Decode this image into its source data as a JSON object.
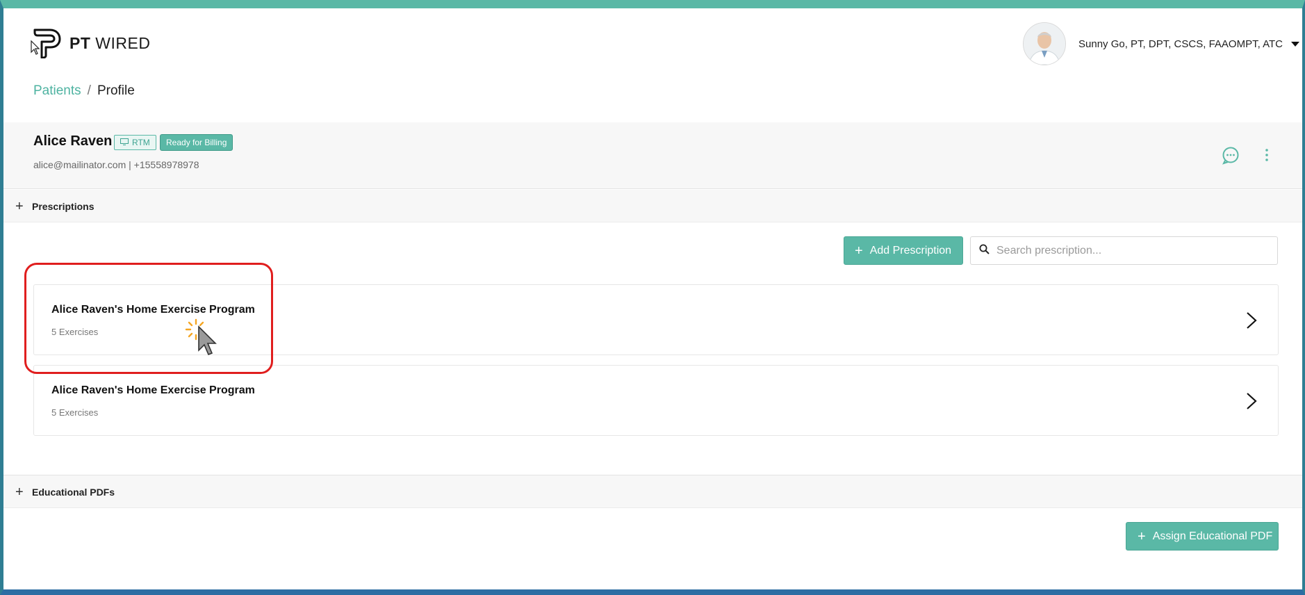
{
  "brand": {
    "name_bold": "PT",
    "name_rest": "WIRED"
  },
  "user": {
    "name": "Sunny Go, PT, DPT, CSCS, FAAOMPT, ATC"
  },
  "breadcrumb": {
    "parent": "Patients",
    "separator": "/",
    "current": "Profile"
  },
  "patient": {
    "name": "Alice Raven",
    "tags": {
      "rtm": "RTM",
      "billing": "Ready for Billing"
    },
    "contact": "alice@mailinator.com | +15558978978"
  },
  "prescriptions": {
    "section_title": "Prescriptions",
    "add_button": "Add Prescription",
    "search_placeholder": "Search prescription...",
    "items": [
      {
        "title": "Alice Raven's Home Exercise Program",
        "subtitle": "5 Exercises"
      },
      {
        "title": "Alice Raven's Home Exercise Program",
        "subtitle": "5 Exercises"
      }
    ]
  },
  "educational_pdfs": {
    "section_title": "Educational PDFs",
    "assign_button": "Assign Educational PDF"
  },
  "colors": {
    "accent": "#5ab8a6",
    "highlight": "#e01e1e",
    "top_border": "#5ab8a6",
    "bottom_border": "#2d6da3"
  },
  "icons": {
    "logo": "pt-logo-icon",
    "section_toggle": "plus-icon",
    "search": "search-icon",
    "chat": "chat-bubble-icon",
    "more": "vertical-dots-icon",
    "chevron": "chevron-right-icon",
    "tag": "monitor-icon",
    "caret": "caret-down-icon"
  }
}
